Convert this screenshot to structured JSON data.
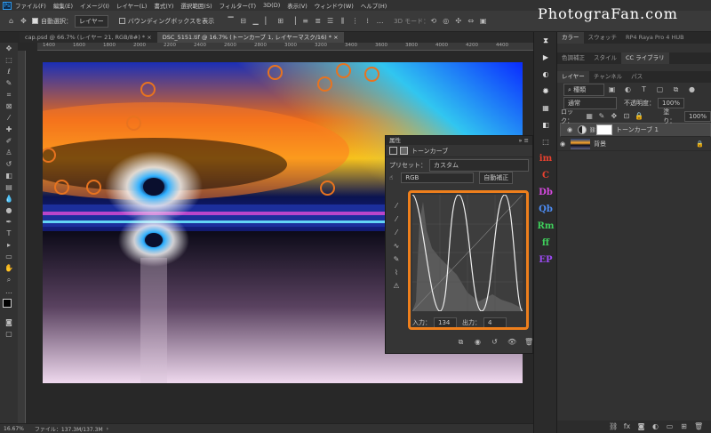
{
  "menubar": {
    "logo": "Ps",
    "items": [
      "ファイル(F)",
      "編集(E)",
      "イメージ(I)",
      "レイヤー(L)",
      "書式(Y)",
      "選択範囲(S)",
      "フィルター(T)",
      "3D(D)",
      "表示(V)",
      "ウィンドウ(W)",
      "ヘルプ(H)"
    ]
  },
  "watermark": "PhotograFan.com",
  "options": {
    "auto_select_label": "自動選択：",
    "auto_select_value": "レイヤー",
    "bounding_box_label": "バウンディングボックスを表示",
    "mode_3d": "3D モード："
  },
  "tabs": [
    {
      "label": "cap.psd @ 66.7% (レイヤー 21, RGB/8#) *"
    },
    {
      "label": "DSC_5151.tif @ 16.7% (トーンカーブ 1, レイヤーマスク/16) *"
    }
  ],
  "ruler_ticks": [
    "1400",
    "1600",
    "1800",
    "2000",
    "2200",
    "2400",
    "2600",
    "2800",
    "3000",
    "3200",
    "3400",
    "3600",
    "3800",
    "4000",
    "4200",
    "4400"
  ],
  "status": {
    "zoom": "16.67%",
    "file": "ファイル：137.3M/137.3M"
  },
  "properties": {
    "title": "属性",
    "kind": "トーンカーブ",
    "preset_label": "プリセット：",
    "preset_value": "カスタム",
    "channel": "RGB",
    "auto_label": "自動補正",
    "input_label": "入力：",
    "input_value": "134",
    "output_label": "出力：",
    "output_value": "4"
  },
  "dock_icons": [
    {
      "glyph": "im",
      "color": "#e8412f"
    },
    {
      "glyph": "C",
      "color": "#e8412f"
    },
    {
      "glyph": "Db",
      "color": "#d64ae0"
    },
    {
      "glyph": "Qb",
      "color": "#4d8df5"
    },
    {
      "glyph": "Rm",
      "color": "#3fcf5b"
    },
    {
      "glyph": "ff",
      "color": "#3fcf5b"
    },
    {
      "glyph": "EP",
      "color": "#9d4bf5"
    }
  ],
  "panel_tabs_top": [
    "カラー",
    "スウォッチ",
    "RP4 Raya Pro 4 HUB"
  ],
  "panel_tabs_mid": [
    "色調補正",
    "スタイル",
    "CC ライブラリ"
  ],
  "layers_tabs": [
    "レイヤー",
    "チャンネル",
    "パス"
  ],
  "layers": {
    "kind_label": "種類",
    "blend": "通常",
    "opacity_label": "不透明度：",
    "opacity_value": "100%",
    "lock_label": "ロック：",
    "fill_label": "塗り：",
    "fill_value": "100%",
    "items": [
      {
        "name": "トーンカーブ 1"
      },
      {
        "name": "背景"
      }
    ]
  }
}
